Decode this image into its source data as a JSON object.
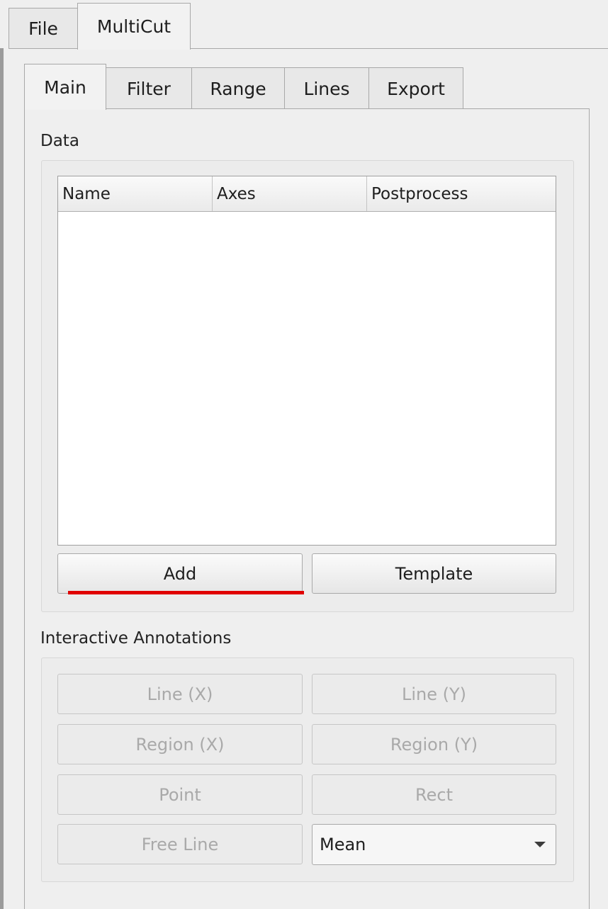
{
  "top_tabs": [
    {
      "label": "File"
    },
    {
      "label": "MultiCut"
    }
  ],
  "inner_tabs": [
    {
      "label": "Main"
    },
    {
      "label": "Filter"
    },
    {
      "label": "Range"
    },
    {
      "label": "Lines"
    },
    {
      "label": "Export"
    }
  ],
  "data_section": {
    "title": "Data",
    "table": {
      "columns": [
        "Name",
        "Axes",
        "Postprocess"
      ],
      "rows": []
    },
    "add_label": "Add",
    "template_label": "Template"
  },
  "annotations_section": {
    "title": "Interactive Annotations",
    "buttons": {
      "line_x": "Line (X)",
      "line_y": "Line (Y)",
      "region_x": "Region (X)",
      "region_y": "Region (Y)",
      "point": "Point",
      "rect": "Rect",
      "free_line": "Free Line"
    },
    "mode_select": {
      "selected": "Mean"
    }
  },
  "colors": {
    "underline_accent": "#e00000",
    "disabled_text": "#a9a9a9"
  }
}
